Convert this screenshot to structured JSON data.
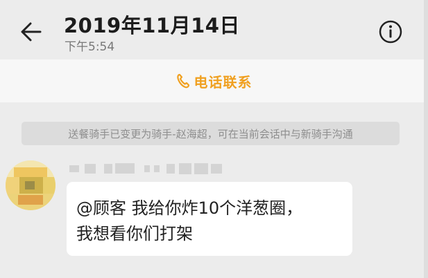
{
  "header": {
    "title": "2019年11月14日",
    "subtitle": "下午5:54",
    "back_icon": "arrow-left-icon",
    "info_icon": "info-circle-icon"
  },
  "call_bar": {
    "icon": "phone-icon",
    "label": "电话联系",
    "color": "#f0a020"
  },
  "notice": {
    "text": "送餐骑手已变更为骑手-赵海超，可在当前会话中与新骑手沟通"
  },
  "message": {
    "avatar": "pixelated-avatar",
    "sender_name_blurred": true,
    "lines": [
      "@顾客 我给你炸10个洋葱圈，",
      "我想看你们打架"
    ]
  },
  "colors": {
    "background": "#ececec",
    "bubble": "#ffffff",
    "accent": "#f0a020"
  }
}
